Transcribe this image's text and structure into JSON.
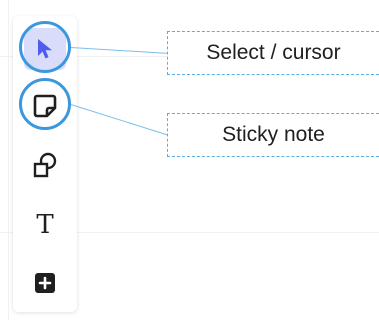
{
  "toolbar": {
    "tools": [
      {
        "name": "select",
        "icon": "cursor-arrow-icon",
        "selected": true
      },
      {
        "name": "sticky-note",
        "icon": "sticky-note-icon",
        "selected": false
      },
      {
        "name": "shapes",
        "icon": "shapes-icon",
        "selected": false
      },
      {
        "name": "text",
        "icon": "text-icon",
        "glyph": "T",
        "selected": false
      },
      {
        "name": "add",
        "icon": "plus-square-icon",
        "selected": false
      }
    ]
  },
  "callouts": {
    "select": "Select / cursor",
    "sticky": "Sticky note"
  },
  "colors": {
    "accent": "#3b97de",
    "selected_bg": "#d9dcfb",
    "cursor_fill": "#4f5cf0",
    "icon": "#1f1f1f"
  }
}
